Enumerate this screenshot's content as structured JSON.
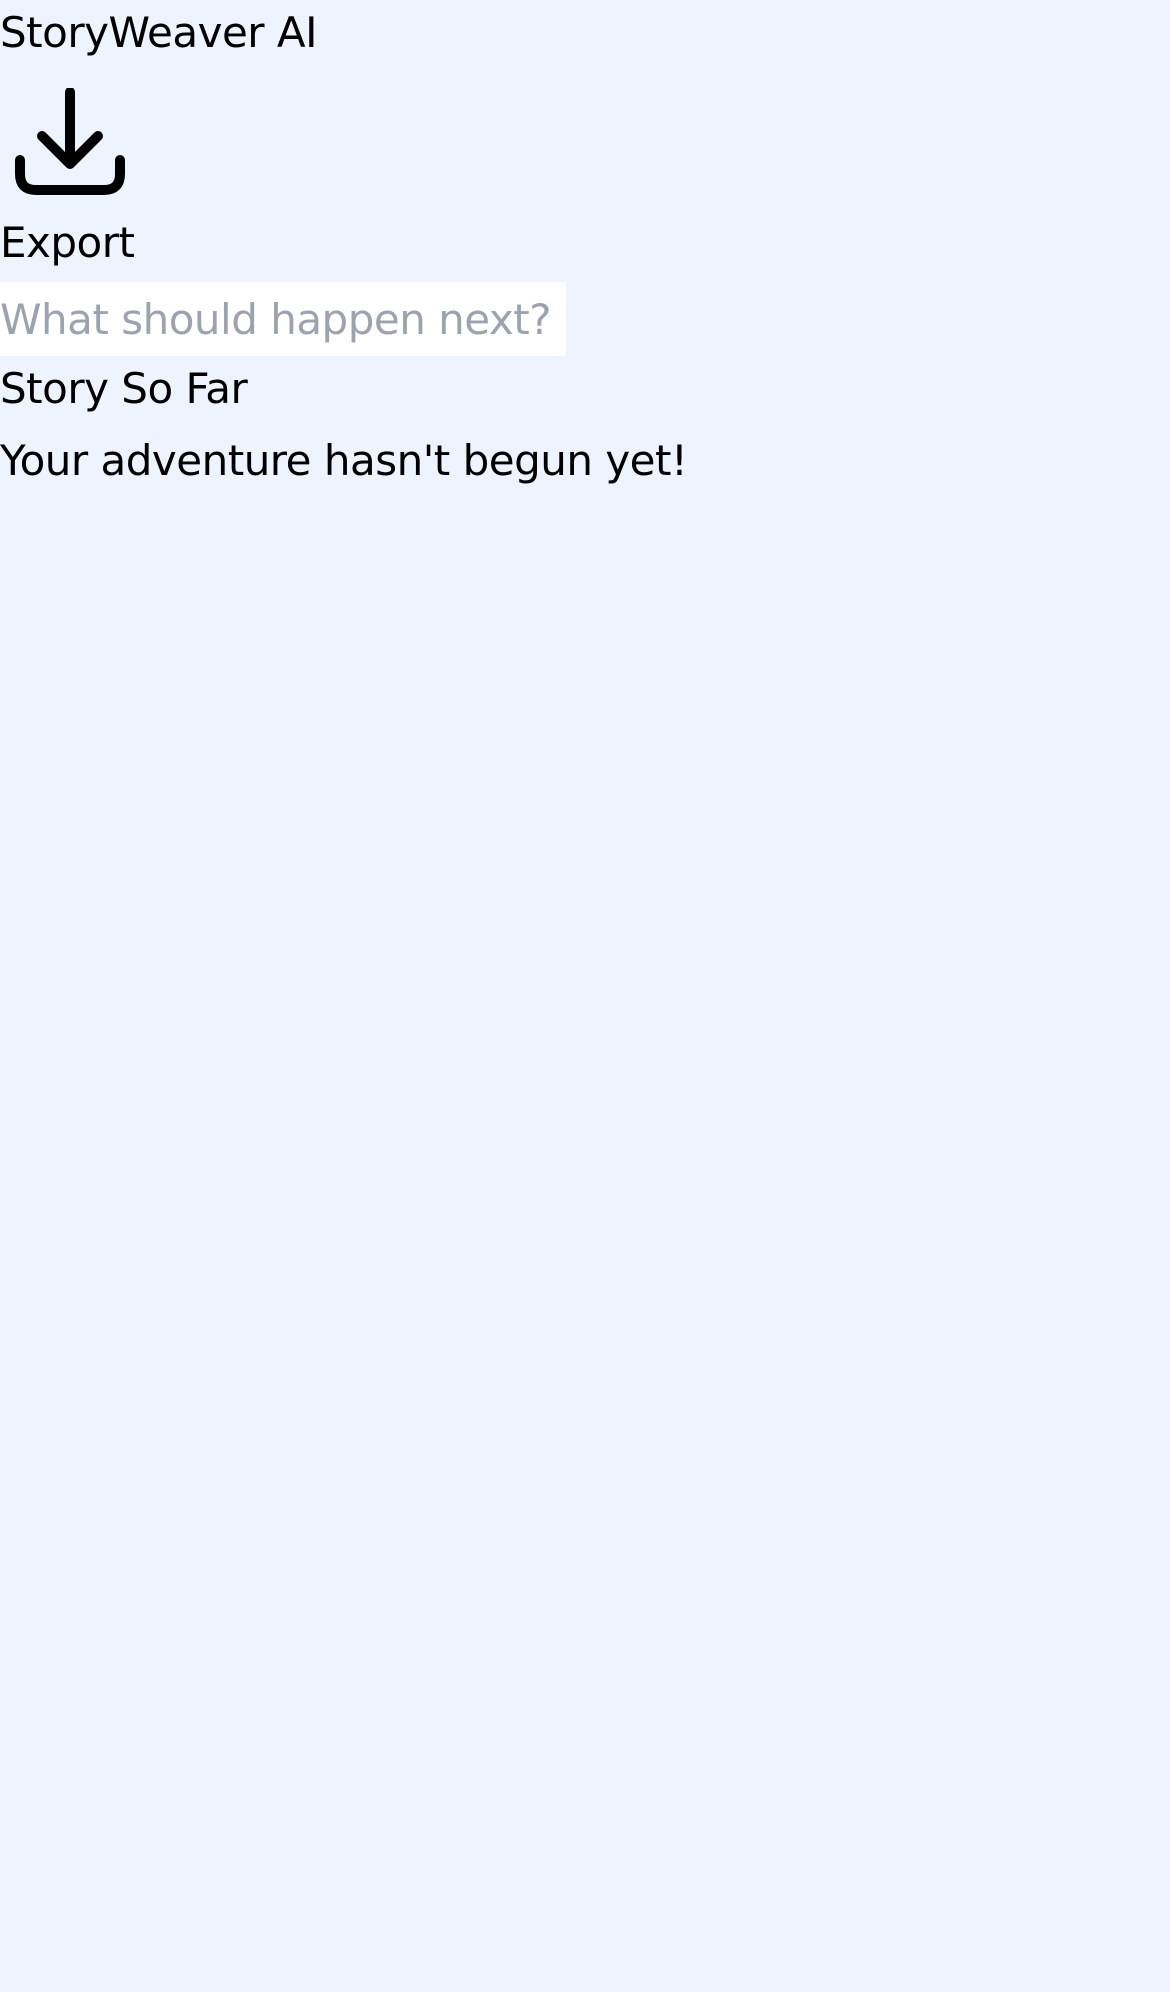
{
  "app": {
    "title": "StoryWeaver AI",
    "background_color": "#eef4ff"
  },
  "toolbar": {
    "export_icon": "download-icon",
    "export_label": "Export"
  },
  "prompt": {
    "value": "",
    "placeholder": "What should happen next?"
  },
  "story": {
    "heading": "Story So Far",
    "empty_message": "Your adventure hasn't begun yet!"
  }
}
